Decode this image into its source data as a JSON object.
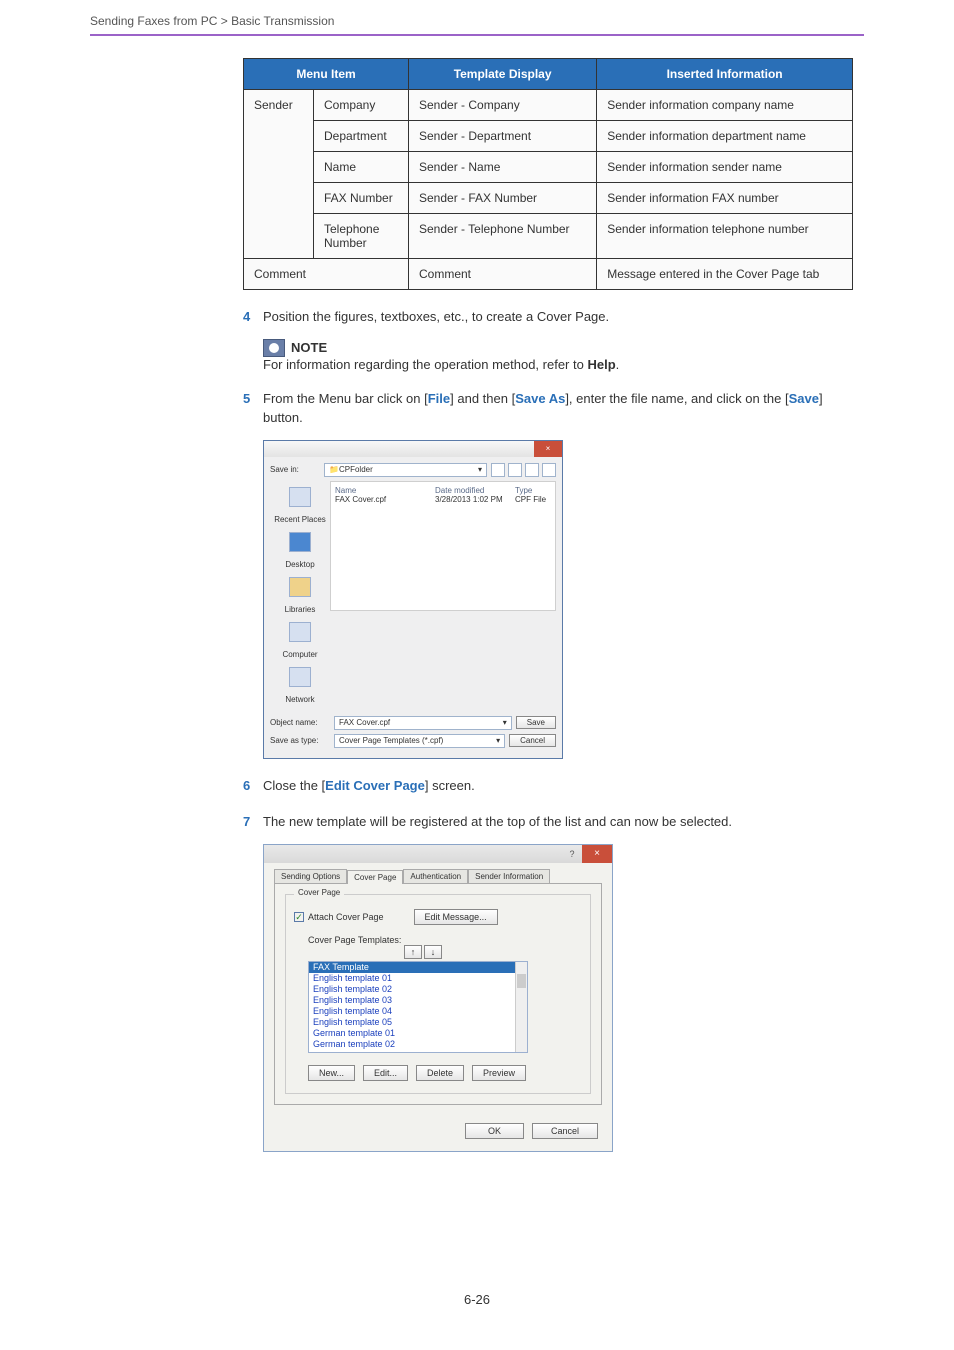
{
  "breadcrumb": "Sending Faxes from PC > Basic Transmission",
  "table": {
    "headers": {
      "menu": "Menu Item",
      "template": "Template Display",
      "inserted": "Inserted Information"
    },
    "rows": [
      {
        "cat": "Sender",
        "sub": "Company",
        "t": "Sender - Company",
        "i": "Sender information company name"
      },
      {
        "sub": "Department",
        "t": "Sender - Department",
        "i": "Sender information department name"
      },
      {
        "sub": "Name",
        "t": "Sender - Name",
        "i": "Sender information sender name"
      },
      {
        "sub": "FAX Number",
        "t": "Sender - FAX Number",
        "i": "Sender information FAX number"
      },
      {
        "sub": "Telephone Number",
        "t": "Sender - Telephone Number",
        "i": "Sender information telephone number"
      },
      {
        "comment": "Comment",
        "t": "Comment",
        "i": "Message entered in the Cover Page tab"
      }
    ]
  },
  "steps": {
    "s4": {
      "n": "4",
      "text": "Position the figures, textboxes, etc., to create a Cover Page."
    },
    "note": {
      "label": "NOTE",
      "text_pre": "For information regarding the operation method, refer to ",
      "help": "Help",
      "text_post": "."
    },
    "s5": {
      "n": "5",
      "pre": "From the Menu bar click on [",
      "file": "File",
      "mid1": "] and then [",
      "saveas": "Save As",
      "mid2": "], enter the file name, and click on the [",
      "save": "Save",
      "post": "] button."
    },
    "s6": {
      "n": "6",
      "pre": "Close the [",
      "link": "Edit Cover Page",
      "post": "] screen."
    },
    "s7": {
      "n": "7",
      "text": "The new template will be registered at the top of the list and can now be selected."
    }
  },
  "saveDialog": {
    "savein_label": "Save in:",
    "savein_value": "CPFolder",
    "col_name": "Name",
    "col_date": "Date modified",
    "col_type": "Type",
    "file_name": "FAX Cover.cpf",
    "file_date": "3/28/2013 1:02 PM",
    "file_type": "CPF File",
    "side": [
      "Recent Places",
      "Desktop",
      "Libraries",
      "Computer",
      "Network"
    ],
    "obj_label": "Object name:",
    "obj_value": "FAX Cover.cpf",
    "type_label": "Save as type:",
    "type_value": "Cover Page Templates (*.cpf)",
    "save_btn": "Save",
    "cancel_btn": "Cancel"
  },
  "dlg2": {
    "tabs": [
      "Sending Options",
      "Cover Page",
      "Authentication",
      "Sender Information"
    ],
    "group_title": "Cover Page",
    "attach": "Attach Cover Page",
    "edit_msg": "Edit Message...",
    "tmpl_label": "Cover Page Templates:",
    "items": [
      "FAX Template",
      "English template 01",
      "English template 02",
      "English template 03",
      "English template 04",
      "English template 05",
      "German template 01",
      "German template 02"
    ],
    "btns": {
      "new": "New...",
      "edit": "Edit...",
      "delete": "Delete",
      "preview": "Preview"
    },
    "ok": "OK",
    "cancel": "Cancel"
  },
  "page_num": "6-26"
}
